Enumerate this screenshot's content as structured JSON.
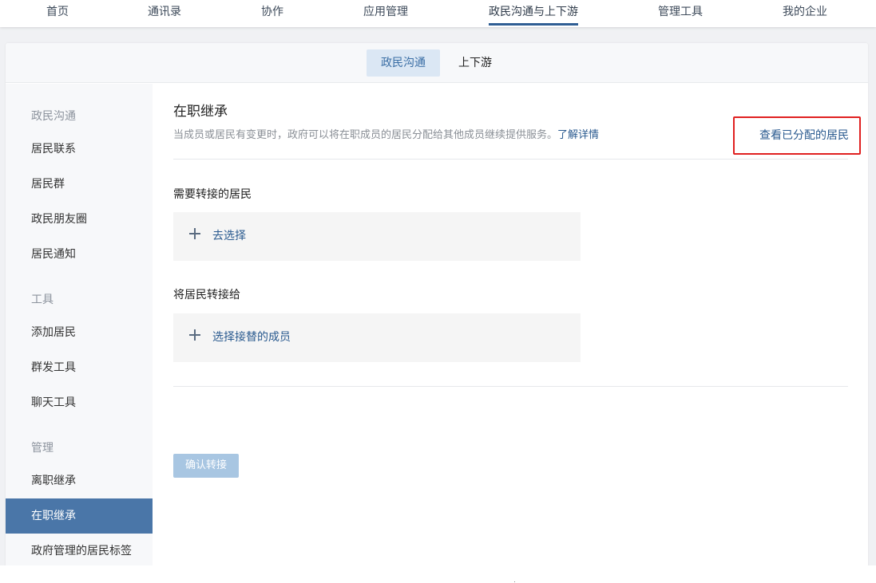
{
  "topnav": {
    "items": [
      {
        "label": "首页"
      },
      {
        "label": "通讯录"
      },
      {
        "label": "协作"
      },
      {
        "label": "应用管理"
      },
      {
        "label": "政民沟通与上下游",
        "active": true
      },
      {
        "label": "管理工具"
      },
      {
        "label": "我的企业"
      }
    ]
  },
  "subtabs": {
    "items": [
      {
        "label": "政民沟通",
        "active": true
      },
      {
        "label": "上下游"
      }
    ]
  },
  "sidebar": {
    "groups": [
      {
        "title": "政民沟通",
        "items": [
          "居民联系",
          "居民群",
          "政民朋友圈",
          "居民通知"
        ]
      },
      {
        "title": "工具",
        "items": [
          "添加居民",
          "群发工具",
          "聊天工具"
        ]
      },
      {
        "title": "管理",
        "items": [
          "离职继承",
          "在职继承",
          "政府管理的居民标签"
        ]
      }
    ],
    "active_item": "在职继承"
  },
  "main": {
    "title": "在职继承",
    "description": "当成员或居民有变更时，政府可以将在职成员的居民分配给其他成员继续提供服务。",
    "learn_more": "了解详情",
    "view_assigned": "查看已分配的居民",
    "section_residents": "需要转接的居民",
    "select_residents": "去选择",
    "section_target": "将居民转接给",
    "select_member": "选择接替的成员",
    "confirm_button": "确认转接"
  },
  "colors": {
    "accent": "#4a76a8",
    "link": "#2a5a8f",
    "highlight_border": "#e02020",
    "disabled_button": "#a8c6e2"
  }
}
